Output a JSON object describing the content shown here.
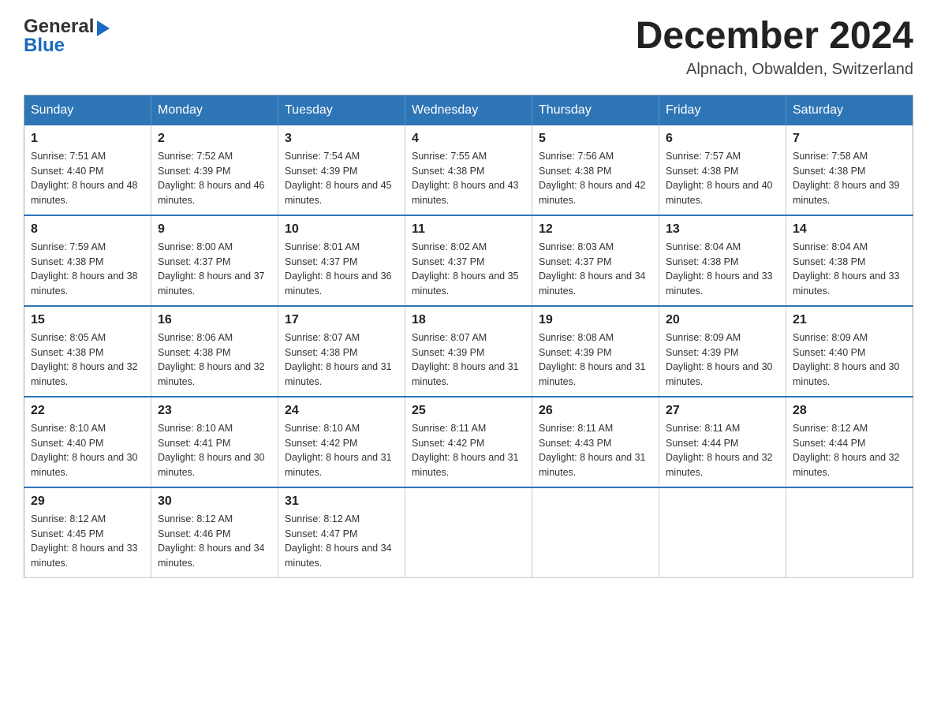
{
  "header": {
    "logo": {
      "general": "General",
      "blue": "Blue"
    },
    "title": "December 2024",
    "location": "Alpnach, Obwalden, Switzerland"
  },
  "calendar": {
    "days_of_week": [
      "Sunday",
      "Monday",
      "Tuesday",
      "Wednesday",
      "Thursday",
      "Friday",
      "Saturday"
    ],
    "weeks": [
      [
        {
          "day": "1",
          "sunrise": "Sunrise: 7:51 AM",
          "sunset": "Sunset: 4:40 PM",
          "daylight": "Daylight: 8 hours and 48 minutes."
        },
        {
          "day": "2",
          "sunrise": "Sunrise: 7:52 AM",
          "sunset": "Sunset: 4:39 PM",
          "daylight": "Daylight: 8 hours and 46 minutes."
        },
        {
          "day": "3",
          "sunrise": "Sunrise: 7:54 AM",
          "sunset": "Sunset: 4:39 PM",
          "daylight": "Daylight: 8 hours and 45 minutes."
        },
        {
          "day": "4",
          "sunrise": "Sunrise: 7:55 AM",
          "sunset": "Sunset: 4:38 PM",
          "daylight": "Daylight: 8 hours and 43 minutes."
        },
        {
          "day": "5",
          "sunrise": "Sunrise: 7:56 AM",
          "sunset": "Sunset: 4:38 PM",
          "daylight": "Daylight: 8 hours and 42 minutes."
        },
        {
          "day": "6",
          "sunrise": "Sunrise: 7:57 AM",
          "sunset": "Sunset: 4:38 PM",
          "daylight": "Daylight: 8 hours and 40 minutes."
        },
        {
          "day": "7",
          "sunrise": "Sunrise: 7:58 AM",
          "sunset": "Sunset: 4:38 PM",
          "daylight": "Daylight: 8 hours and 39 minutes."
        }
      ],
      [
        {
          "day": "8",
          "sunrise": "Sunrise: 7:59 AM",
          "sunset": "Sunset: 4:38 PM",
          "daylight": "Daylight: 8 hours and 38 minutes."
        },
        {
          "day": "9",
          "sunrise": "Sunrise: 8:00 AM",
          "sunset": "Sunset: 4:37 PM",
          "daylight": "Daylight: 8 hours and 37 minutes."
        },
        {
          "day": "10",
          "sunrise": "Sunrise: 8:01 AM",
          "sunset": "Sunset: 4:37 PM",
          "daylight": "Daylight: 8 hours and 36 minutes."
        },
        {
          "day": "11",
          "sunrise": "Sunrise: 8:02 AM",
          "sunset": "Sunset: 4:37 PM",
          "daylight": "Daylight: 8 hours and 35 minutes."
        },
        {
          "day": "12",
          "sunrise": "Sunrise: 8:03 AM",
          "sunset": "Sunset: 4:37 PM",
          "daylight": "Daylight: 8 hours and 34 minutes."
        },
        {
          "day": "13",
          "sunrise": "Sunrise: 8:04 AM",
          "sunset": "Sunset: 4:38 PM",
          "daylight": "Daylight: 8 hours and 33 minutes."
        },
        {
          "day": "14",
          "sunrise": "Sunrise: 8:04 AM",
          "sunset": "Sunset: 4:38 PM",
          "daylight": "Daylight: 8 hours and 33 minutes."
        }
      ],
      [
        {
          "day": "15",
          "sunrise": "Sunrise: 8:05 AM",
          "sunset": "Sunset: 4:38 PM",
          "daylight": "Daylight: 8 hours and 32 minutes."
        },
        {
          "day": "16",
          "sunrise": "Sunrise: 8:06 AM",
          "sunset": "Sunset: 4:38 PM",
          "daylight": "Daylight: 8 hours and 32 minutes."
        },
        {
          "day": "17",
          "sunrise": "Sunrise: 8:07 AM",
          "sunset": "Sunset: 4:38 PM",
          "daylight": "Daylight: 8 hours and 31 minutes."
        },
        {
          "day": "18",
          "sunrise": "Sunrise: 8:07 AM",
          "sunset": "Sunset: 4:39 PM",
          "daylight": "Daylight: 8 hours and 31 minutes."
        },
        {
          "day": "19",
          "sunrise": "Sunrise: 8:08 AM",
          "sunset": "Sunset: 4:39 PM",
          "daylight": "Daylight: 8 hours and 31 minutes."
        },
        {
          "day": "20",
          "sunrise": "Sunrise: 8:09 AM",
          "sunset": "Sunset: 4:39 PM",
          "daylight": "Daylight: 8 hours and 30 minutes."
        },
        {
          "day": "21",
          "sunrise": "Sunrise: 8:09 AM",
          "sunset": "Sunset: 4:40 PM",
          "daylight": "Daylight: 8 hours and 30 minutes."
        }
      ],
      [
        {
          "day": "22",
          "sunrise": "Sunrise: 8:10 AM",
          "sunset": "Sunset: 4:40 PM",
          "daylight": "Daylight: 8 hours and 30 minutes."
        },
        {
          "day": "23",
          "sunrise": "Sunrise: 8:10 AM",
          "sunset": "Sunset: 4:41 PM",
          "daylight": "Daylight: 8 hours and 30 minutes."
        },
        {
          "day": "24",
          "sunrise": "Sunrise: 8:10 AM",
          "sunset": "Sunset: 4:42 PM",
          "daylight": "Daylight: 8 hours and 31 minutes."
        },
        {
          "day": "25",
          "sunrise": "Sunrise: 8:11 AM",
          "sunset": "Sunset: 4:42 PM",
          "daylight": "Daylight: 8 hours and 31 minutes."
        },
        {
          "day": "26",
          "sunrise": "Sunrise: 8:11 AM",
          "sunset": "Sunset: 4:43 PM",
          "daylight": "Daylight: 8 hours and 31 minutes."
        },
        {
          "day": "27",
          "sunrise": "Sunrise: 8:11 AM",
          "sunset": "Sunset: 4:44 PM",
          "daylight": "Daylight: 8 hours and 32 minutes."
        },
        {
          "day": "28",
          "sunrise": "Sunrise: 8:12 AM",
          "sunset": "Sunset: 4:44 PM",
          "daylight": "Daylight: 8 hours and 32 minutes."
        }
      ],
      [
        {
          "day": "29",
          "sunrise": "Sunrise: 8:12 AM",
          "sunset": "Sunset: 4:45 PM",
          "daylight": "Daylight: 8 hours and 33 minutes."
        },
        {
          "day": "30",
          "sunrise": "Sunrise: 8:12 AM",
          "sunset": "Sunset: 4:46 PM",
          "daylight": "Daylight: 8 hours and 34 minutes."
        },
        {
          "day": "31",
          "sunrise": "Sunrise: 8:12 AM",
          "sunset": "Sunset: 4:47 PM",
          "daylight": "Daylight: 8 hours and 34 minutes."
        },
        null,
        null,
        null,
        null
      ]
    ]
  }
}
